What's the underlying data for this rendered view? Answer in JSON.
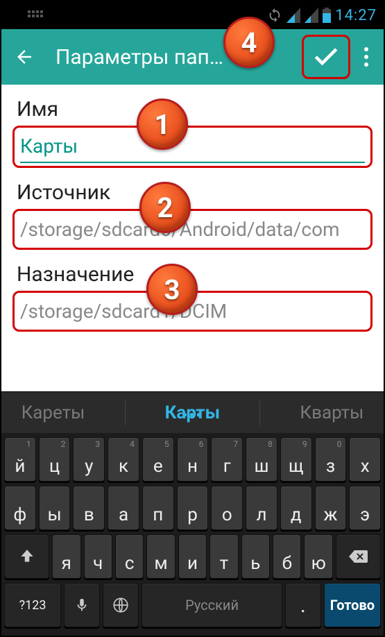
{
  "statusbar": {
    "time": "14:27"
  },
  "actionbar": {
    "title": "Параметры пап…"
  },
  "form": {
    "name_label": "Имя",
    "name_value": "Карты",
    "source_label": "Источник",
    "source_value": "/storage/sdcard0/Android/data/com",
    "dest_label": "Назначение",
    "dest_value": "/storage/sdcard1/DCIM"
  },
  "annotations": {
    "b1": "1",
    "b2": "2",
    "b3": "3",
    "b4": "4"
  },
  "suggestions": {
    "left": "Кареты",
    "mid": "Карты",
    "right": "Кварты"
  },
  "keyboard": {
    "row1": [
      {
        "l": "й",
        "h": "1"
      },
      {
        "l": "ц",
        "h": "2"
      },
      {
        "l": "у",
        "h": "3"
      },
      {
        "l": "к",
        "h": "4"
      },
      {
        "l": "е",
        "h": "5"
      },
      {
        "l": "н",
        "h": "6"
      },
      {
        "l": "г",
        "h": "7"
      },
      {
        "l": "ш",
        "h": "8"
      },
      {
        "l": "щ",
        "h": "9"
      },
      {
        "l": "з",
        "h": "0"
      },
      {
        "l": "х",
        "h": ""
      }
    ],
    "row2": [
      {
        "l": "ф"
      },
      {
        "l": "ы"
      },
      {
        "l": "в"
      },
      {
        "l": "а"
      },
      {
        "l": "п"
      },
      {
        "l": "р"
      },
      {
        "l": "о"
      },
      {
        "l": "л"
      },
      {
        "l": "д"
      },
      {
        "l": "ж"
      },
      {
        "l": "э"
      }
    ],
    "row3": [
      {
        "l": "я"
      },
      {
        "l": "ч"
      },
      {
        "l": "с"
      },
      {
        "l": "м"
      },
      {
        "l": "и"
      },
      {
        "l": "т"
      },
      {
        "l": "ь"
      },
      {
        "l": "б"
      },
      {
        "l": "ю"
      }
    ],
    "bottom": {
      "symbols": "?123",
      "space": "Русский",
      "period": ".",
      "done": "Готово"
    }
  }
}
